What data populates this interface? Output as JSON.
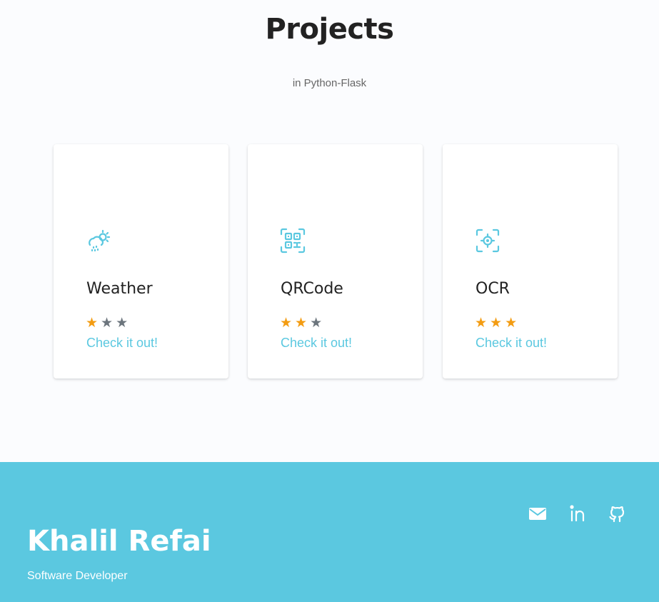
{
  "header": {
    "title": "Projects",
    "subtitle": "in Python-Flask"
  },
  "projects": [
    {
      "name": "Weather",
      "icon": "weather-sun-rain-icon",
      "rating": 1,
      "max_rating": 5,
      "link_label": "Check it out!"
    },
    {
      "name": "QRCode",
      "icon": "qr-code-icon",
      "rating": 2,
      "max_rating": 5,
      "link_label": "Check it out!"
    },
    {
      "name": "OCR",
      "icon": "scan-focus-icon",
      "rating": 3,
      "max_rating": 5,
      "link_label": "Check it out!"
    }
  ],
  "footer": {
    "name": "Khalil Refai",
    "role": "Software Developer",
    "social_icons": [
      "mail-icon",
      "linkedin-icon",
      "github-icon"
    ]
  },
  "colors": {
    "accent": "#5bc8e0",
    "star_filled": "#f39c12",
    "star_empty": "#6c757d",
    "footer_bg": "#5bc8e0"
  }
}
